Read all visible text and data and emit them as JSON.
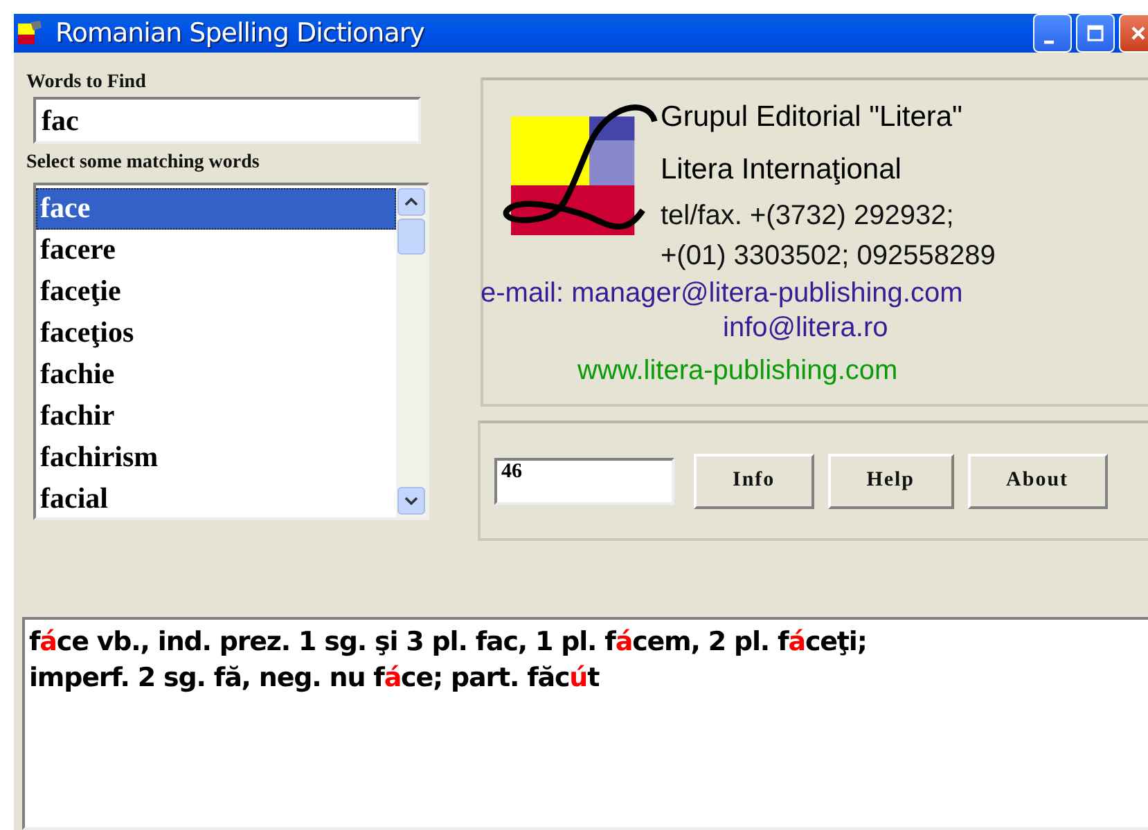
{
  "window": {
    "title": "Romanian Spelling Dictionary"
  },
  "search": {
    "label": "Words to Find",
    "value": "fac"
  },
  "matches": {
    "label": "Select some matching words",
    "items": [
      {
        "word": "face",
        "selected": true
      },
      {
        "word": "facere",
        "selected": false
      },
      {
        "word": "faceţie",
        "selected": false
      },
      {
        "word": "faceţios",
        "selected": false
      },
      {
        "word": "fachie",
        "selected": false
      },
      {
        "word": "fachir",
        "selected": false
      },
      {
        "word": "fachirism",
        "selected": false
      },
      {
        "word": "facial",
        "selected": false
      }
    ]
  },
  "publisher": {
    "lines": [
      {
        "kind": "heading",
        "text": "Grupul Editorial \"Litera\""
      },
      {
        "kind": "heading",
        "text": "Litera Internaţional"
      },
      {
        "kind": "phone",
        "text": "tel/fax. +(3732) 292932;"
      },
      {
        "kind": "phone",
        "text": "+(01) 3303502; 092558289"
      },
      {
        "kind": "email",
        "text": "e-mail: manager@litera-publishing.com"
      },
      {
        "kind": "email-center",
        "text": "info@litera.ro"
      },
      {
        "kind": "web",
        "text": "www.litera-publishing.com"
      }
    ]
  },
  "count": {
    "value": "46"
  },
  "buttons": [
    "Info",
    "Help",
    "About"
  ],
  "definition": {
    "lines": [
      [
        {
          "text": "f",
          "accent": false
        },
        {
          "text": "á",
          "accent": true
        },
        {
          "text": "ce vb., ind. prez. 1 sg. şi 3 pl. fac, 1 pl. f",
          "accent": false
        },
        {
          "text": "á",
          "accent": true
        },
        {
          "text": "cem, 2 pl. f",
          "accent": false
        },
        {
          "text": "á",
          "accent": true
        },
        {
          "text": "ceţi;",
          "accent": false
        }
      ],
      [
        {
          "text": "imperf. 2 sg. fă, neg. nu f",
          "accent": false
        },
        {
          "text": "á",
          "accent": true
        },
        {
          "text": "ce; part. făc",
          "accent": false
        },
        {
          "text": "ú",
          "accent": true
        },
        {
          "text": "t",
          "accent": false
        }
      ]
    ]
  }
}
